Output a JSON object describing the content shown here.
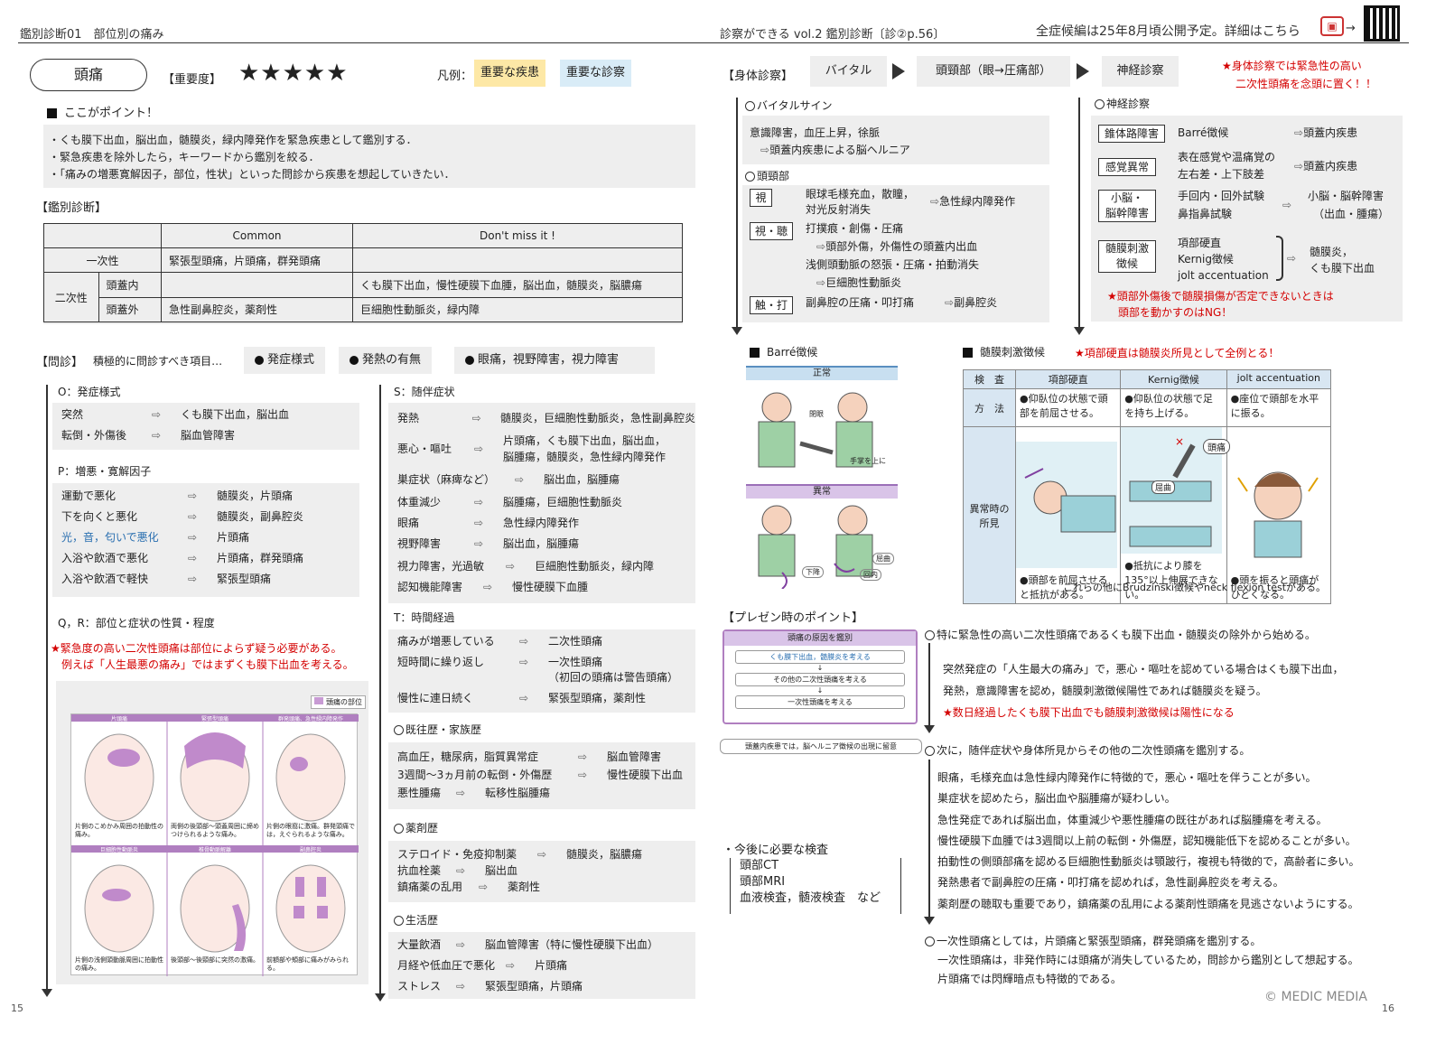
{
  "header": {
    "left": "鑑別診断01　部位別の痛み",
    "center": "診察ができる vol.2 鑑別診断〔診②p.56〕",
    "right": "全症候編は25年8月頃公開予定。詳細はこちら",
    "arrow": "→"
  },
  "title": {
    "name": "頭痛",
    "importance_label": "【重要度】",
    "stars": "★★★★★",
    "legend_label": "凡例：",
    "legend_disease": "重要な疾患",
    "legend_exam": "重要な診察"
  },
  "points": {
    "heading": "ここがポイント！",
    "items": [
      "・くも膜下出血，脳出血，髄膜炎，緑内障発作を緊急疾患として鑑別する．",
      "・緊急疾患を除外したら，キーワードから鑑別を絞る．",
      "・「痛みの増悪寛解因子，部位，性状」といった問診から疾患を想起していきたい．"
    ]
  },
  "ddx": {
    "heading": "【鑑別診断】",
    "col_common": "Common",
    "col_dontmiss": "Don't miss it !",
    "primary": "一次性",
    "primary_common": "緊張型頭痛，片頭痛，群発頭痛",
    "secondary": "二次性",
    "intra": "頭蓋内",
    "intra_dontmiss": "くも膜下出血，慢性硬膜下血腫，脳出血，髄膜炎，脳膿瘍",
    "extra": "頭蓋外",
    "extra_common": "急性副鼻腔炎，薬剤性",
    "extra_dontmiss": "巨細胞性動脈炎，緑内障"
  },
  "interview": {
    "heading": "【問診】",
    "lead": "積極的に問診すべき項目…",
    "chips": [
      "発症様式",
      "発熱の有無",
      "眼痛，視野障害，視力障害"
    ]
  },
  "onset": {
    "heading": "O：発症様式",
    "rows": [
      {
        "k": "突然",
        "v": "くも膜下出血，脳出血"
      },
      {
        "k": "転倒・外傷後",
        "v": "脳血管障害"
      }
    ]
  },
  "palliative": {
    "heading": "P：増悪・寛解因子",
    "rows": [
      {
        "k": "運動で悪化",
        "v": "髄膜炎，片頭痛"
      },
      {
        "k": "下を向くと悪化",
        "v": "髄膜炎，副鼻腔炎"
      },
      {
        "k": "光，音，匂いで悪化",
        "v": "片頭痛"
      },
      {
        "k": "入浴や飲酒で悪化",
        "v": "片頭痛，群発頭痛"
      },
      {
        "k": "入浴や飲酒で軽快",
        "v": "緊張型頭痛"
      }
    ]
  },
  "qr": {
    "heading": "Q，R：部位と症状の性質・程度",
    "note1": "★緊急度の高い二次性頭痛は部位によらず疑う必要がある。",
    "note2": "例えば「人生最悪の痛み」ではまずくも膜下出血を考える。"
  },
  "head_fig": {
    "legend": "頭痛の部位",
    "cells": [
      {
        "title": "片頭痛",
        "cap": "片側のこめかみ周囲の拍動性の痛み。"
      },
      {
        "title": "緊張型頭痛",
        "cap": "両側の後頭部〜頭蓋周囲に締めつけられるような痛み。"
      },
      {
        "title": "群発頭痛、急性緑内障発作",
        "cap": "片側の眼窩に激痛。群発頭痛では，えぐられるような痛み。"
      },
      {
        "title": "巨細胞性動脈炎",
        "cap": "片側の浅側頭動脈周囲に拍動性の痛み。"
      },
      {
        "title": "椎骨動脈解離",
        "cap": "後頭部〜後頸部に突然の激痛。"
      },
      {
        "title": "副鼻腔炎",
        "cap": "前額部や頬部に痛みがみられる。"
      }
    ]
  },
  "symptoms": {
    "heading": "S：随伴症状",
    "rows": [
      {
        "k": "発熱",
        "v": "髄膜炎，巨細胞性動脈炎，急性副鼻腔炎"
      },
      {
        "k": "悪心・嘔吐",
        "v": "片頭痛，くも膜下出血，脳出血，",
        "v2": "脳腫瘍，髄膜炎，急性緑内障発作"
      },
      {
        "k": "巣症状（麻痺など）",
        "v": "脳出血，脳腫瘍"
      },
      {
        "k": "体重減少",
        "v": "脳腫瘍，巨細胞性動脈炎"
      },
      {
        "k": "眼痛",
        "v": "急性緑内障発作"
      },
      {
        "k": "視野障害",
        "v": "脳出血，脳腫瘍"
      },
      {
        "k": "視力障害，光過敏",
        "v": "巨細胞性動脈炎，緑内障"
      },
      {
        "k": "認知機能障害",
        "v": "慢性硬膜下血腫"
      }
    ]
  },
  "time": {
    "heading": "T：時間経過",
    "rows": [
      {
        "k": "痛みが増悪している",
        "v": "二次性頭痛"
      },
      {
        "k": "短時間に繰り返し",
        "v": "一次性頭痛",
        "v2": "（初回の頭痛は警告頭痛）"
      },
      {
        "k": "慢性に連日続く",
        "v": "緊張型頭痛，薬剤性"
      }
    ]
  },
  "history": {
    "heading": "既往歴・家族歴",
    "rows": [
      {
        "k": "高血圧，糖尿病，脂質異常症",
        "v": "脳血管障害"
      },
      {
        "k": "3週間〜3ヵ月前の転倒・外傷歴",
        "v": "慢性硬膜下出血"
      },
      {
        "k": "悪性腫瘍",
        "v": "転移性脳腫瘍"
      }
    ]
  },
  "drugs": {
    "heading": "薬剤歴",
    "rows": [
      {
        "k": "ステロイド・免疫抑制薬",
        "v": "髄膜炎，脳膿瘍"
      },
      {
        "k": "抗血栓薬",
        "v": "脳出血"
      },
      {
        "k": "鎮痛薬の乱用",
        "v": "薬剤性"
      }
    ]
  },
  "life": {
    "heading": "生活歴",
    "rows": [
      {
        "k": "大量飲酒",
        "v": "脳血管障害（特に慢性硬膜下出血）"
      },
      {
        "k": "月経や低血圧で悪化",
        "v": "片頭痛"
      },
      {
        "k": "ストレス",
        "v": "緊張型頭痛，片頭痛"
      }
    ]
  },
  "exam": {
    "heading": "【身体診察】",
    "steps": [
      "バイタル",
      "頭頸部（眼→圧痛部）",
      "神経診察"
    ],
    "note1": "★身体診察では緊急性の高い",
    "note2": "二次性頭痛を念頭に置く！！"
  },
  "vital": {
    "heading": "バイタルサイン",
    "l1": "意識障害，血圧上昇，徐脈",
    "l2": "頭蓋内疾患による脳ヘルニア"
  },
  "headneck": {
    "heading": "頭頸部",
    "b1": "視",
    "b1a": "眼球毛様充血，散瞳，",
    "b1b": "対光反射消失",
    "b1r": "急性緑内障発作",
    "b2": "視・聴",
    "b2a": "打撲痕・創傷・圧痛",
    "b2b": "頭部外傷，外傷性の頭蓋内出血",
    "b2c": "浅側頭動脈の怒張・圧痛・拍動消失",
    "b2d": "巨細胞性動脈炎",
    "b3": "触・打",
    "b3a": "副鼻腔の圧痛・叩打痛",
    "b3r": "副鼻腔炎"
  },
  "neuro": {
    "heading": "神経診察",
    "rows": [
      {
        "k": "錐体路障害",
        "a": "Barré徴候",
        "r": "頭蓋内疾患"
      },
      {
        "k": "感覚異常",
        "a": "表在感覚や温痛覚の",
        "a2": "左右差・上下肢差",
        "r": "頭蓋内疾患"
      },
      {
        "k": "小脳・",
        "k2": "脳幹障害",
        "a": "手回内・回外試験",
        "a2": "鼻指鼻試験",
        "r": "小脳・脳幹障害",
        "r2": "（出血・腫瘍）"
      },
      {
        "k": "髄膜刺激",
        "k2": "徴候",
        "a": "項部硬直",
        "a2": "Kernig徴候",
        "a3": "jolt accentuation",
        "r": "髄膜炎，",
        "r2": "くも膜下出血"
      }
    ],
    "note1": "★頭部外傷後で髄膜損傷が否定できないときは",
    "note2": "頭部を動かすのはNG！"
  },
  "barre": {
    "heading": "Barré徴候",
    "normal": "正常",
    "abnormal": "異常",
    "l1": "閉眼",
    "l2": "手掌を上に",
    "l3": "下降",
    "l4": "回内",
    "l5": "屈曲"
  },
  "meningeal": {
    "heading": "髄膜刺激徴候",
    "note": "★項部硬直は髄膜炎所見として全例とる！",
    "col0": "検　査",
    "col1": "項部硬直",
    "col2": "Kernig徴候",
    "col3": "jolt accentuation",
    "row1": "方　法",
    "m1": "●仰臥位の状態で頭部を前屈させる。",
    "m2": "●仰臥位の状態で足を持ち上げる。",
    "m3": "●座位で頭部を水平に振る。",
    "row2": "異常時の所見",
    "f1": "●頭部を前屈させると抵抗がある。",
    "f2": "●抵抗により膝を135°以上伸展できない。",
    "f3": "●頭を振ると頭痛がひどくなる。",
    "lbl_pain": "頭痛",
    "lbl_knee": "屈曲",
    "foot": "これらの他にBrudzinski徴候やneck flexion testがある。"
  },
  "present": {
    "heading": "【プレゼン時のポイント】",
    "flow_title": "頭痛の原因を鑑別",
    "f1": "くも膜下出血，髄膜炎を考える",
    "f2": "その他の二次性頭痛を考える",
    "f3": "一次性頭痛を考える",
    "flow_note": "頭蓋内疾患では，脳ヘルニア徴候の出現に留意",
    "p1": "特に緊急性の高い二次性頭痛であるくも膜下出血・髄膜炎の除外から始める。",
    "p1a": "突然発症の「人生最大の痛み」で，悪心・嘔吐を認めている場合はくも膜下出血，",
    "p1b": "発熱，意識障害を認め，髄膜刺激徴候陽性であれば髄膜炎を疑う。",
    "p1c": "★数日経過したくも膜下出血でも髄膜刺激徴候は陽性になる",
    "p2": "次に，随伴症状や身体所見からその他の二次性頭痛を鑑別する。",
    "p2a": "眼痛，毛様充血は急性緑内障発作に特徴的で，悪心・嘔吐を伴うことが多い。",
    "p2b": "巣症状を認めたら，脳出血や脳腫瘍が疑わしい。",
    "p2c": "急性発症であれば脳出血，体重減少や悪性腫瘍の既往があれば脳腫瘍を考える。",
    "p2d": "慢性硬膜下血腫では3週間以上前の転倒・外傷歴，認知機能低下を認めることが多い。",
    "p2e": "拍動性の側頭部痛を認める巨細胞性動脈炎は顎跛行，複視も特徴的で，高齢者に多い。",
    "p2f": "発熱患者で副鼻腔の圧痛・叩打痛を認めれば，急性副鼻腔炎を考える。",
    "p2g": "薬剤歴の聴取も重要であり，鎮痛薬の乱用による薬剤性頭痛を見逃さないようにする。",
    "p3": "一次性頭痛としては，片頭痛と緊張型頭痛，群発頭痛を鑑別する。",
    "p3a": "一次性頭痛は，非発作時には頭痛が消失しているため，問診から鑑別として想起する。",
    "p3b": "片頭痛では閃輝暗点も特徴的である。"
  },
  "tests": {
    "heading": "・今後に必要な検査",
    "items": [
      "頭部CT",
      "頭部MRI",
      "血液検査，髄液検査　など"
    ]
  },
  "footer": {
    "page_left": "15",
    "page_right": "16",
    "copyright": "© MEDIC MEDIA"
  },
  "colors": {
    "disease_hl": "#fde8a6",
    "exam_hl": "#d9ecf7",
    "red": "#d40000",
    "purple": "#b07fc0",
    "box_bg": "#eeeeee"
  }
}
